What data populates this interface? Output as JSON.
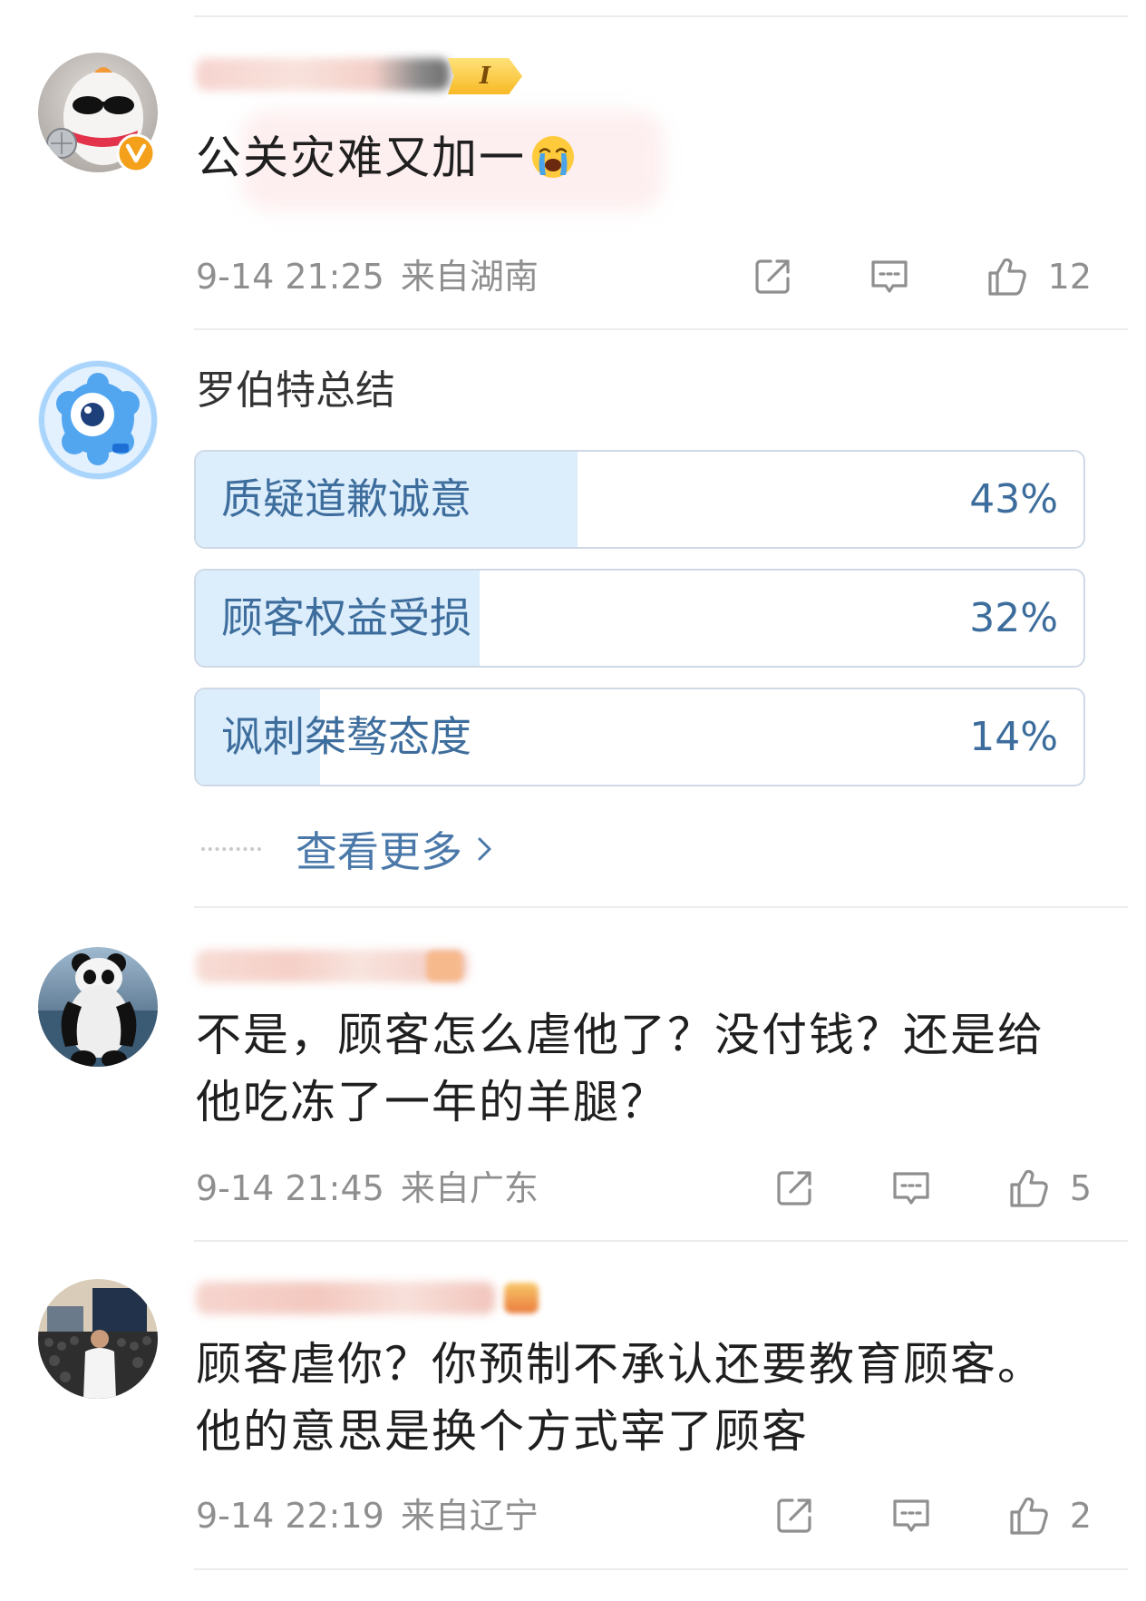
{
  "comments": [
    {
      "text": "公关灾难又加一",
      "level_badge": "I",
      "time": "9-14 21:25",
      "location": "来自湖南",
      "likes": "12"
    },
    {
      "text": "不是，顾客怎么虐他了？没付钱？还是给他吃冻了一年的羊腿？",
      "time": "9-14 21:45",
      "location": "来自广东",
      "likes": "5"
    },
    {
      "text": "顾客虐你？你预制不承认还要教育顾客。他的意思是换个方式宰了顾客",
      "time": "9-14 22:19",
      "location": "来自辽宁",
      "likes": "2"
    }
  ],
  "poll": {
    "author": "罗伯特总结",
    "options": [
      {
        "label": "质疑道歉诚意",
        "percent": 43,
        "percent_label": "43%"
      },
      {
        "label": "顾客权益受损",
        "percent": 32,
        "percent_label": "32%"
      },
      {
        "label": "讽刺桀骜态度",
        "percent": 14,
        "percent_label": "14%"
      }
    ],
    "more_label": "查看更多"
  },
  "icons": {
    "share": "share-icon",
    "comment": "comment-icon",
    "like": "like-icon",
    "verified": "verified-badge-icon",
    "emoji": "loudly-crying-face-emoji",
    "more": "chevron-right-icon"
  },
  "colors": {
    "poll_fill": "#dcedfb",
    "poll_text": "#3d6d9c",
    "link_blue": "#4a78a8",
    "meta_gray": "#8f8f8f",
    "verified_orange": "#f5a01a",
    "level_badge_yellow": "#f7b924"
  }
}
